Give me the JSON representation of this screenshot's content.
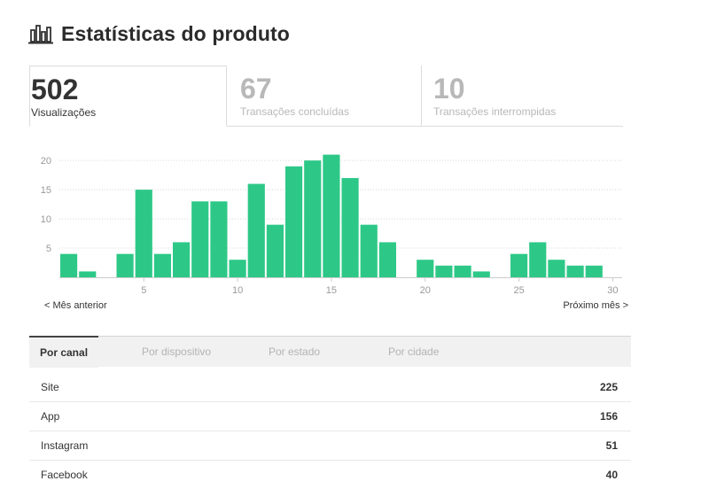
{
  "header": {
    "title": "Estatísticas do produto"
  },
  "stats": [
    {
      "value": "502",
      "label": "Visualizações"
    },
    {
      "value": "67",
      "label": "Transações concluídas"
    },
    {
      "value": "10",
      "label": "Transações interrompidas"
    }
  ],
  "nav": {
    "prev": "< Mês anterior",
    "next": "Próximo mês >"
  },
  "tabs": [
    "Por canal",
    "Por dispositivo",
    "Por estado",
    "Por cidade"
  ],
  "rows": [
    {
      "name": "Site",
      "value": "225"
    },
    {
      "name": "App",
      "value": "156"
    },
    {
      "name": "Instagram",
      "value": "51"
    },
    {
      "name": "Facebook",
      "value": "40"
    }
  ],
  "colors": {
    "bar": "#2dc887",
    "grid": "#d8d8d8",
    "text": "#333333",
    "muted": "#b8b8b8"
  },
  "chart_data": {
    "type": "bar",
    "categories": [
      1,
      2,
      3,
      4,
      5,
      6,
      7,
      8,
      9,
      10,
      11,
      12,
      13,
      14,
      15,
      16,
      17,
      18,
      19,
      20,
      21,
      22,
      23,
      24,
      25,
      26,
      27,
      28,
      29,
      30
    ],
    "values": [
      4,
      1,
      0,
      4,
      15,
      4,
      6,
      13,
      13,
      3,
      16,
      9,
      19,
      20,
      21,
      17,
      9,
      6,
      0,
      3,
      2,
      2,
      1,
      0,
      4,
      6,
      3,
      2,
      2,
      0
    ],
    "x_ticks": [
      5,
      10,
      15,
      20,
      25,
      30
    ],
    "y_ticks": [
      5,
      10,
      15,
      20
    ],
    "ylim": [
      0,
      22
    ],
    "grid": true
  }
}
